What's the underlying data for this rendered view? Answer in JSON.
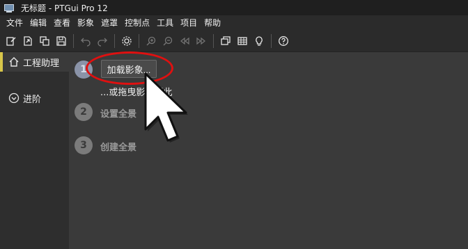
{
  "window": {
    "title": "无标题 - PTGui Pro 12"
  },
  "menu": [
    "文件",
    "编辑",
    "查看",
    "影象",
    "遮罩",
    "控制点",
    "工具",
    "项目",
    "帮助"
  ],
  "toolbar": {
    "icons": [
      "new-project-icon",
      "open-project-icon",
      "copy-icon",
      "save-icon",
      "undo-icon",
      "redo-icon",
      "settings-icon",
      "zoom-in-icon",
      "zoom-out-icon",
      "previous-icon",
      "next-icon",
      "panorama-editor-icon",
      "table-icon",
      "lightbulb-icon",
      "help-icon"
    ]
  },
  "sidebar": {
    "items": [
      {
        "label": "工程助理",
        "icon": "home-icon",
        "active": true
      },
      {
        "label": "进阶",
        "icon": "chevron-down-circle-icon",
        "active": false
      }
    ],
    "accent_color": "#d8c64a"
  },
  "workflow": {
    "step1": {
      "number": "1",
      "button_label": "加载影象...",
      "hint": "...或拖曳影像到此"
    },
    "step2": {
      "number": "2",
      "label": "设置全景"
    },
    "step3": {
      "number": "3",
      "label": "创建全景"
    }
  },
  "annotation": {
    "highlight_color": "#e01010"
  }
}
